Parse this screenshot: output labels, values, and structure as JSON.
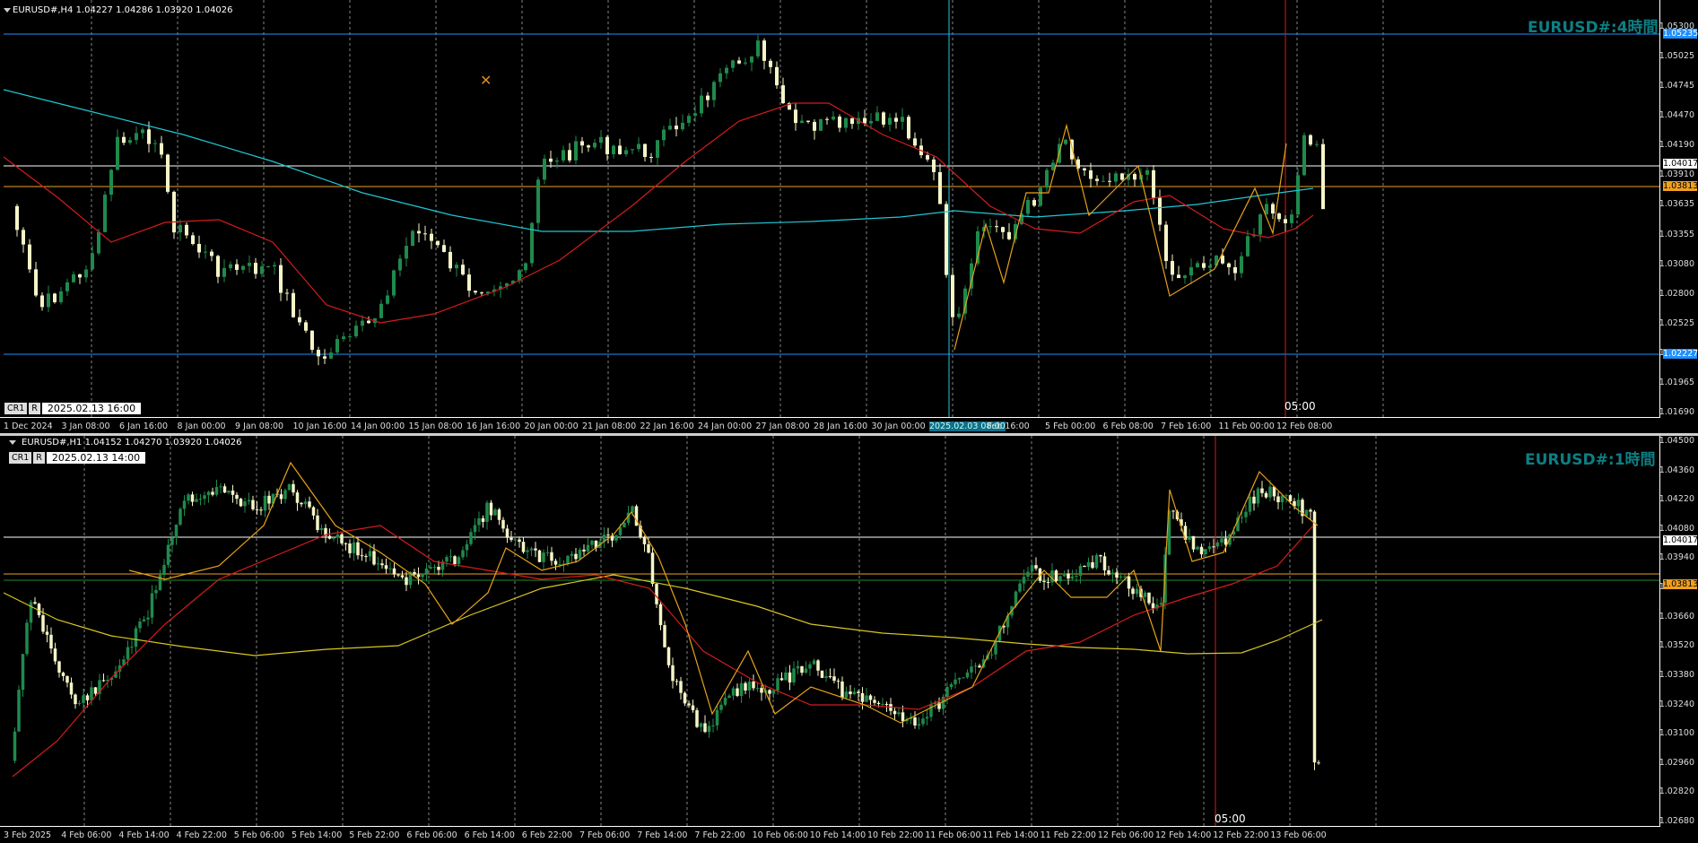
{
  "top": {
    "header": "EURUSD#,H4  1.04227 1.04286 1.03920 1.04026",
    "title": "EURUSD#:4時間",
    "crosshair_date": "2025.02.13 16:00",
    "cr1": "CR1",
    "r": "R",
    "vline_marker": "05:00",
    "selected_time": "2025.02.03 08:00",
    "price_ticks": [
      "1.05300",
      "1.05025",
      "1.04745",
      "1.04470",
      "1.04190",
      "1.03910",
      "1.03635",
      "1.03355",
      "1.03080",
      "1.02800",
      "1.02525",
      "1.02245",
      "1.01965",
      "1.01690"
    ],
    "tags": {
      "blue_top": "1.05235",
      "white": "1.04017",
      "orange": "1.03813",
      "blue_bottom": "1.02227"
    },
    "time_labels": [
      "1 Dec 2024",
      "3 Jan 08:00",
      "6 Jan 16:00",
      "8 Jan 00:00",
      "9 Jan 08:00",
      "10 Jan 16:00",
      "14 Jan 00:00",
      "15 Jan 08:00",
      "16 Jan 16:00",
      "20 Jan 00:00",
      "21 Jan 08:00",
      "22 Jan 16:00",
      "24 Jan 00:00",
      "27 Jan 08:00",
      "28 Jan 16:00",
      "30 Jan 00:00",
      "2025.02.03 08:00",
      "Feb 16:00",
      "5 Feb 00:00",
      "6 Feb 08:00",
      "7 Feb 16:00",
      "11 Feb 00:00",
      "12 Feb 08:00"
    ]
  },
  "bottom": {
    "header": "EURUSD#,H1  1.04152 1.04270 1.03920 1.04026",
    "title": "EURUSD#:1時間",
    "crosshair_date": "2025.02.13 14:00",
    "cr1": "CR1",
    "r": "R",
    "vline_marker": "05:00",
    "price_ticks": [
      "1.04500",
      "1.04360",
      "1.04220",
      "1.04080",
      "1.03940",
      "1.03800",
      "1.03660",
      "1.03520",
      "1.03380",
      "1.03240",
      "1.03100",
      "1.02960",
      "1.02820",
      "1.02680"
    ],
    "tags": {
      "white": "1.04017",
      "orange": "1.03813"
    },
    "time_labels": [
      "3 Feb 2025",
      "4 Feb 06:00",
      "4 Feb 14:00",
      "4 Feb 22:00",
      "5 Feb 06:00",
      "5 Feb 14:00",
      "5 Feb 22:00",
      "6 Feb 06:00",
      "6 Feb 14:00",
      "6 Feb 22:00",
      "7 Feb 06:00",
      "7 Feb 14:00",
      "7 Feb 22:00",
      "10 Feb 06:00",
      "10 Feb 14:00",
      "10 Feb 22:00",
      "11 Feb 06:00",
      "11 Feb 14:00",
      "11 Feb 22:00",
      "12 Feb 06:00",
      "12 Feb 14:00",
      "12 Feb 22:00",
      "13 Feb 06:00"
    ]
  },
  "colors": {
    "bull": "#1f8a4c",
    "bear": "#f5f5c8",
    "ma_fast": "#d41c1c",
    "ma_slow_top": "#1fc7d4",
    "ma_slow_bot": "#d8c820",
    "zigzag": "#e6a21a",
    "orange_line": "#f0a020",
    "blue_line": "#1e90ff",
    "title": "#0d7f84"
  },
  "icons": {
    "cursor": "crosshair-tool-icon"
  }
}
